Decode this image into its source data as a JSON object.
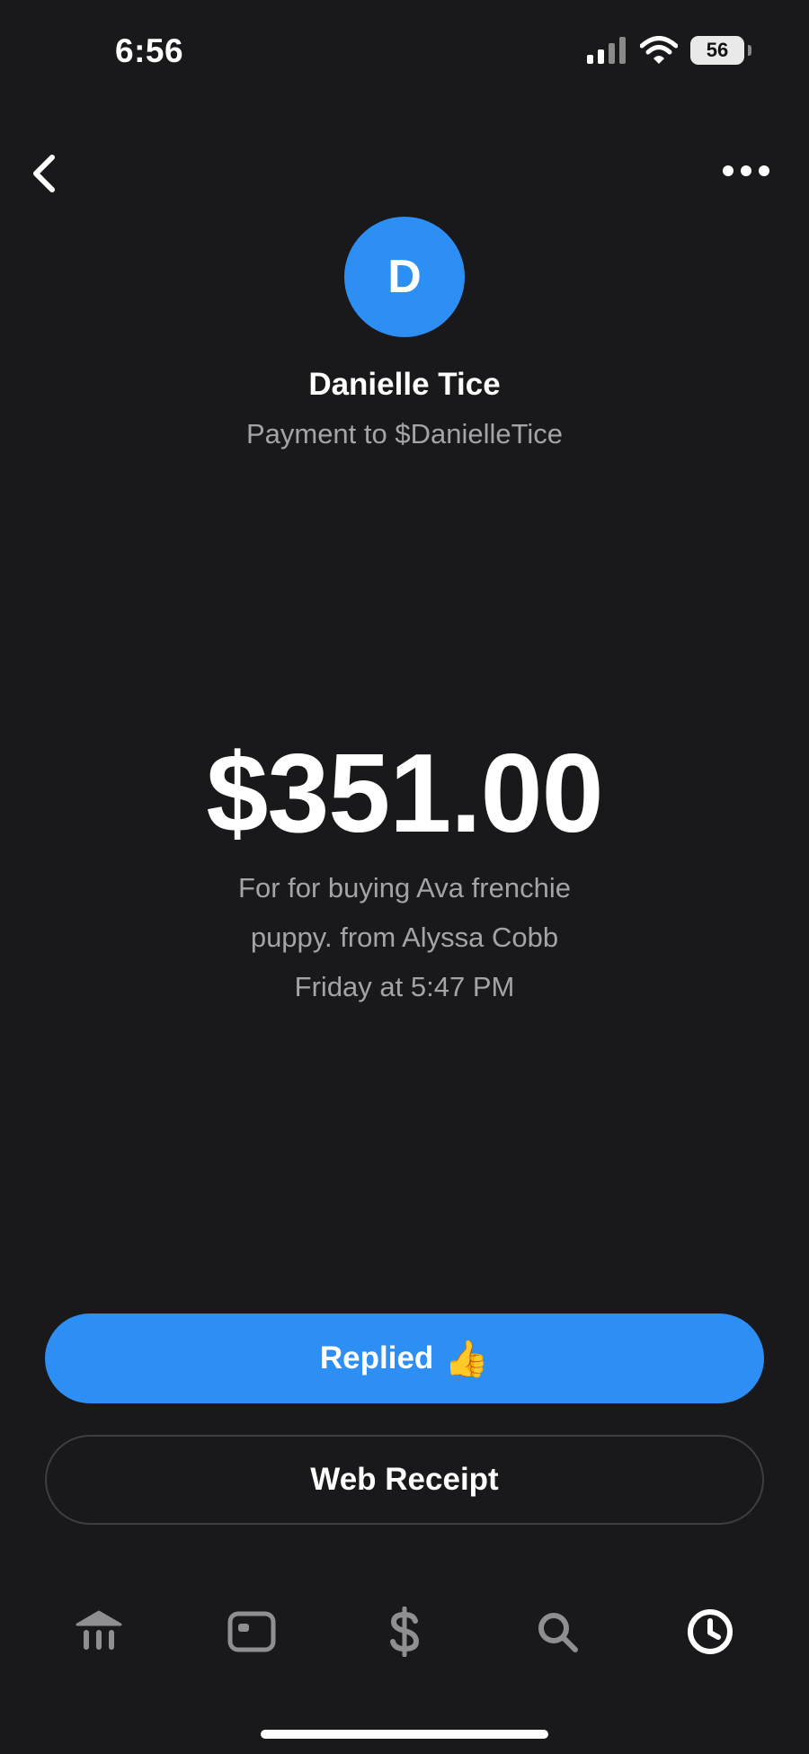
{
  "status_bar": {
    "time": "6:56",
    "battery": "56"
  },
  "profile": {
    "initial": "D",
    "name": "Danielle Tice",
    "subtitle": "Payment to $DanielleTice",
    "avatar_color": "#2d8ef3"
  },
  "payment": {
    "amount": "$351.00",
    "note_line_1": "For for buying Ava frenchie",
    "note_line_2": "puppy. from Alyssa Cobb",
    "date": "Friday at 5:47 PM"
  },
  "actions": {
    "replied_label": "Replied",
    "replied_emoji": "👍",
    "receipt_label": "Web Receipt"
  },
  "tab_bar": {
    "items": [
      {
        "icon": "bank-icon",
        "active": false
      },
      {
        "icon": "card-icon",
        "active": false
      },
      {
        "icon": "dollar-icon",
        "active": false
      },
      {
        "icon": "search-icon",
        "active": false
      },
      {
        "icon": "clock-icon",
        "active": true
      }
    ]
  },
  "colors": {
    "background": "#19191b",
    "accent": "#2d8ef3",
    "muted_text": "#a3a3a8"
  }
}
